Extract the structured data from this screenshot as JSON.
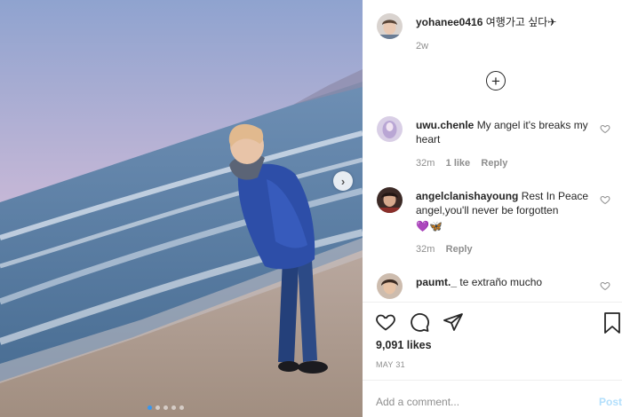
{
  "post": {
    "author": "yohanee0416",
    "caption": "여행가고 싶다✈",
    "time": "2w",
    "load_more_icon": "plus-circle-icon"
  },
  "comments": [
    {
      "user": "uwu.chenle",
      "text": "My angel it's breaks my heart",
      "time": "32m",
      "likes": "1 like",
      "reply": "Reply"
    },
    {
      "user": "angelclanishayoung",
      "text": "Rest In Peace angel,you'll never be forgotten",
      "emoji": "💜🦋",
      "time": "32m",
      "reply": "Reply"
    },
    {
      "user": "paumt._",
      "text": "te extraño mucho"
    }
  ],
  "footer": {
    "likes": "9,091 likes",
    "date": "MAY 31",
    "add_comment_placeholder": "Add a comment...",
    "post_label": "Post"
  },
  "media": {
    "next_icon": "chevron-right-icon",
    "dots": 5,
    "active_dot": 0
  },
  "colors": {
    "link_blue": "#3897f0",
    "post_disabled": "#b2dffc",
    "meta_gray": "#8e8e8e"
  }
}
